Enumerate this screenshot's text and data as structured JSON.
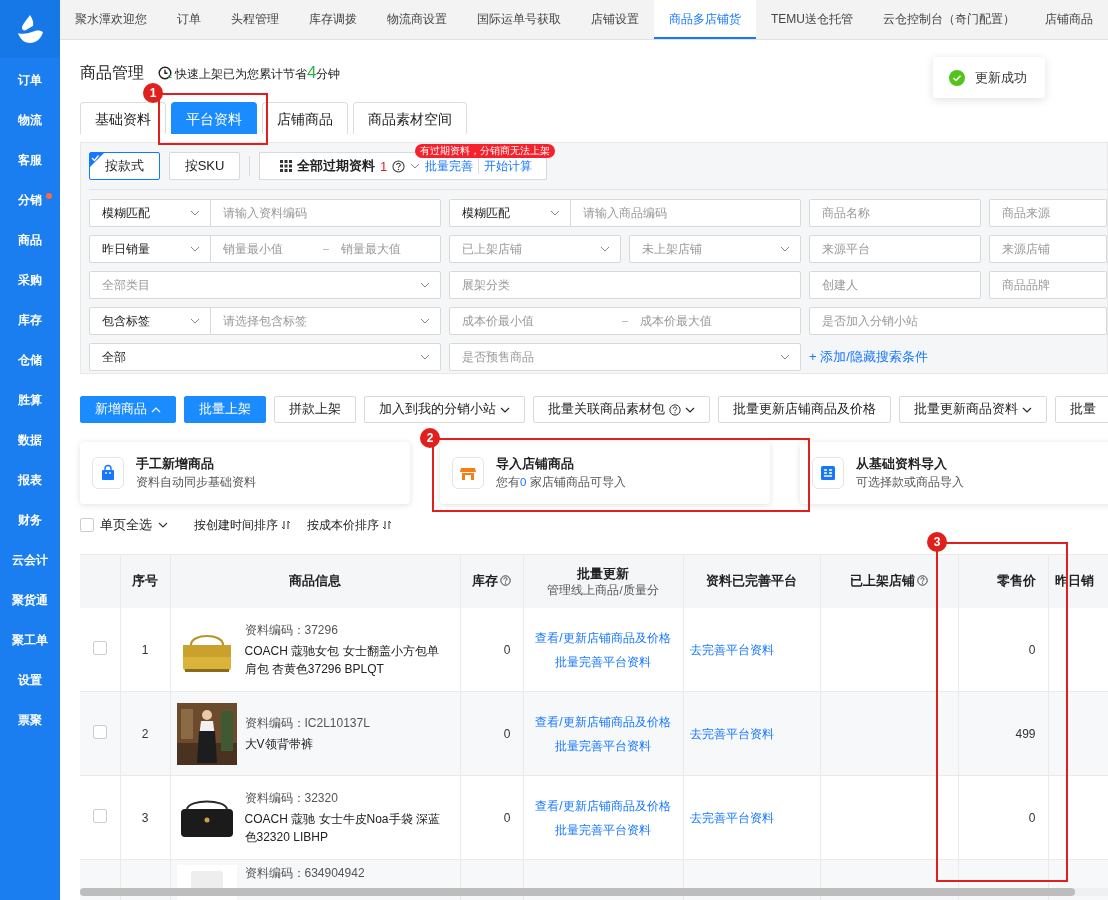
{
  "sidebar": {
    "items": [
      {
        "label": "订单",
        "badge": false
      },
      {
        "label": "物流",
        "badge": false
      },
      {
        "label": "客服",
        "badge": false
      },
      {
        "label": "分销",
        "badge": true
      },
      {
        "label": "商品",
        "badge": false
      },
      {
        "label": "采购",
        "badge": false
      },
      {
        "label": "库存",
        "badge": false
      },
      {
        "label": "仓储",
        "badge": false
      },
      {
        "label": "胜算",
        "badge": false
      },
      {
        "label": "数据",
        "badge": false
      },
      {
        "label": "报表",
        "badge": false
      },
      {
        "label": "财务",
        "badge": false
      },
      {
        "label": "云会计",
        "badge": false
      },
      {
        "label": "聚货通",
        "badge": false
      },
      {
        "label": "聚工单",
        "badge": false
      },
      {
        "label": "设置",
        "badge": false
      },
      {
        "label": "票聚",
        "badge": false
      }
    ]
  },
  "top_tabs": [
    {
      "label": "聚水潭欢迎您",
      "selected": false
    },
    {
      "label": "订单",
      "selected": false
    },
    {
      "label": "头程管理",
      "selected": false
    },
    {
      "label": "库存调拨",
      "selected": false
    },
    {
      "label": "物流商设置",
      "selected": false
    },
    {
      "label": "国际运单号获取",
      "selected": false
    },
    {
      "label": "店铺设置",
      "selected": false
    },
    {
      "label": "商品多店铺货",
      "selected": true
    },
    {
      "label": "TEMU送仓托管",
      "selected": false
    },
    {
      "label": "云仓控制台（奇门配置）",
      "selected": false
    },
    {
      "label": "店铺商品",
      "selected": false
    }
  ],
  "page": {
    "title": "商品管理",
    "saving_prefix": "快速上架已为您累计节省",
    "saving_value": "4",
    "saving_suffix": "分钟"
  },
  "view_tabs": [
    {
      "label": "基础资料",
      "selected": false
    },
    {
      "label": "平台资料",
      "selected": true
    },
    {
      "label": "店铺商品",
      "selected": false
    },
    {
      "label": "商品素材空间",
      "selected": false
    }
  ],
  "filter": {
    "modes": [
      {
        "label": "按款式",
        "selected": true
      },
      {
        "label": "按SKU",
        "selected": false
      }
    ],
    "expired": {
      "label": "全部过期资料",
      "count": "1",
      "badge": "有过期资料，分销商无法上架",
      "actions": [
        "批量完善",
        "开始计算"
      ]
    },
    "rows": [
      [
        {
          "kind": "combo",
          "select": "模糊匹配",
          "placeholder": "请输入资料编码"
        },
        {
          "kind": "combo",
          "select": "模糊匹配",
          "placeholder": "请输入商品编码"
        },
        {
          "kind": "input",
          "placeholder": "商品名称"
        },
        {
          "kind": "input",
          "placeholder": "商品来源"
        }
      ],
      [
        {
          "kind": "combo-range",
          "select": "昨日销量",
          "fields": [
            {
              "placeholder": "销量最小值"
            },
            {
              "placeholder": "销量最大值"
            }
          ]
        },
        {
          "kind": "select-pair",
          "selects": [
            {
              "placeholder": "已上架店铺"
            },
            {
              "placeholder": "未上架店铺"
            }
          ]
        },
        {
          "kind": "input",
          "placeholder": "来源平台"
        },
        {
          "kind": "input",
          "placeholder": "来源店铺"
        }
      ],
      [
        {
          "kind": "select-wide",
          "placeholder": "全部类目"
        },
        {
          "kind": "input-wide",
          "placeholder": "展架分类"
        },
        {
          "kind": "input",
          "placeholder": "创建人"
        },
        {
          "kind": "input",
          "placeholder": "商品品牌"
        }
      ],
      [
        {
          "kind": "combo-select",
          "select": "包含标签",
          "placeholder": "请选择包含标签"
        },
        {
          "kind": "range",
          "fields": [
            {
              "placeholder": "成本价最小值"
            },
            {
              "placeholder": "成本价最大值"
            }
          ]
        },
        {
          "kind": "input-wide",
          "placeholder": "是否加入分销小站"
        }
      ],
      [
        {
          "kind": "select-wide",
          "value": "全部"
        },
        {
          "kind": "select-wide",
          "placeholder": "是否预售商品"
        },
        {
          "kind": "link",
          "label": "+ 添加/隐藏搜索条件"
        }
      ]
    ]
  },
  "actions": [
    {
      "label": "新增商品",
      "kind": "primary",
      "dropdown": true,
      "expanded": true,
      "help": false
    },
    {
      "label": "批量上架",
      "kind": "primary",
      "dropdown": false,
      "help": false
    },
    {
      "label": "拼款上架",
      "kind": "default",
      "dropdown": false,
      "help": false
    },
    {
      "label": "加入到我的分销小站",
      "kind": "default",
      "dropdown": true,
      "expanded": false,
      "help": false
    },
    {
      "label": "批量关联商品素材包",
      "kind": "default",
      "dropdown": true,
      "expanded": false,
      "help": true
    },
    {
      "label": "批量更新店铺商品及价格",
      "kind": "default",
      "dropdown": false,
      "help": false
    },
    {
      "label": "批量更新商品资料",
      "kind": "default",
      "dropdown": true,
      "expanded": false,
      "help": false
    },
    {
      "label": "批量",
      "kind": "default",
      "dropdown": false,
      "help": false
    }
  ],
  "add_options": [
    {
      "kind": "bag",
      "title": "手工新增商品",
      "sub": "资料自动同步基础资料"
    },
    {
      "kind": "shop",
      "title": "导入店铺商品",
      "sub": "您有",
      "count": "0",
      "sub_suffix": "家店铺商品可导入"
    },
    {
      "kind": "list",
      "title": "从基础资料导入",
      "sub": "可选择款或商品导入"
    }
  ],
  "sort_bar": {
    "select_all": {
      "label": "单页全选",
      "checked": false
    },
    "sorts": [
      "按创建时间排序",
      "按成本价排序"
    ]
  },
  "table": {
    "columns": [
      {
        "label": "序号"
      },
      {
        "label": "商品信息"
      },
      {
        "label": "库存",
        "help": true
      },
      {
        "label": "批量更新",
        "sub": "管理线上商品/质量分"
      },
      {
        "label": "资料已完善平台"
      },
      {
        "label": "已上架店铺",
        "help": true
      },
      {
        "label": "零售价"
      },
      {
        "label": "昨日销"
      }
    ],
    "rows": [
      {
        "checked": false,
        "index": "1",
        "code": "资料编码：37296",
        "name": "COACH 蔻驰女包 女士翻盖小方包单肩包 杏黄色37296 BPLQT",
        "stock": "0",
        "actions": [
          "查看/更新店铺商品及价格",
          "批量完善平台资料"
        ],
        "platform_link": "去完善平台资料",
        "price": "0"
      },
      {
        "checked": false,
        "index": "2",
        "code": "资料编码：IC2L10137L",
        "name": "大V领背带裤",
        "stock": "0",
        "actions": [
          "查看/更新店铺商品及价格",
          "批量完善平台资料"
        ],
        "platform_link": "去完善平台资料",
        "price": "499"
      },
      {
        "checked": false,
        "index": "3",
        "code": "资料编码：32320",
        "name": "COACH 蔻驰 女士牛皮Noa手袋 深蓝色32320 LIBHP",
        "stock": "0",
        "actions": [
          "查看/更新店铺商品及价格",
          "批量完善平台资料"
        ],
        "platform_link": "去完善平台资料",
        "price": "0"
      },
      {
        "code": "资料编码：634904942"
      }
    ]
  },
  "toast": {
    "text": "更新成功"
  },
  "callouts": [
    {
      "number": "1"
    },
    {
      "number": "2"
    },
    {
      "number": "3"
    }
  ]
}
